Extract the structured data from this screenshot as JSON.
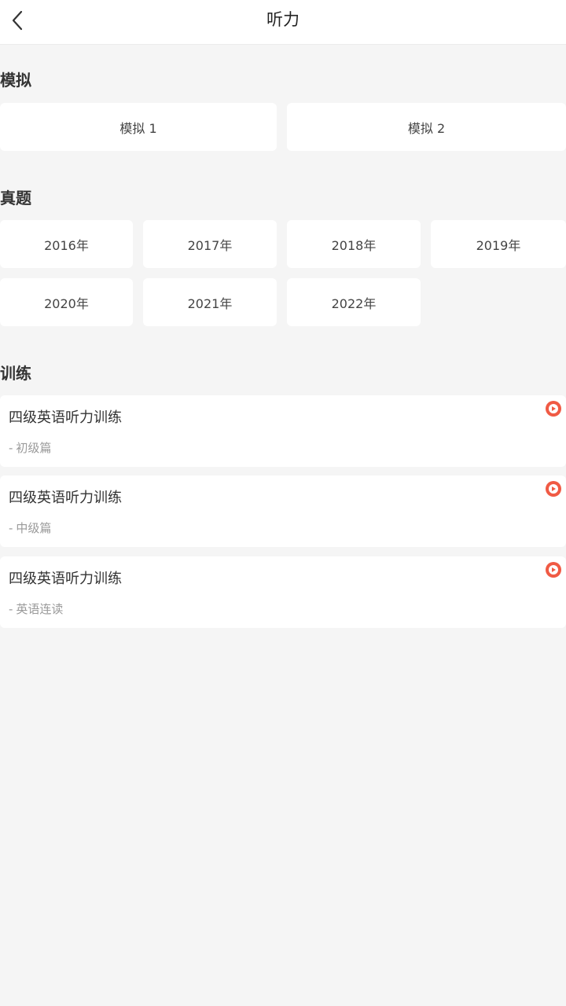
{
  "header": {
    "title": "听力"
  },
  "sections": {
    "mock": {
      "title": "模拟",
      "items": [
        "模拟 1",
        "模拟 2"
      ]
    },
    "past": {
      "title": "真题",
      "items": [
        "2016年",
        "2017年",
        "2018年",
        "2019年",
        "2020年",
        "2021年",
        "2022年"
      ]
    },
    "training": {
      "title": "训练",
      "items": [
        {
          "title": "四级英语听力训练",
          "subtitle": "初级篇"
        },
        {
          "title": "四级英语听力训练",
          "subtitle": "中级篇"
        },
        {
          "title": "四级英语听力训练",
          "subtitle": "英语连读"
        }
      ]
    }
  },
  "colors": {
    "background": "#f5f5f5",
    "card": "#ffffff",
    "accent": "#f05a44"
  },
  "icons": {
    "back": "chevron-left-icon",
    "play": "play-circle-icon"
  }
}
